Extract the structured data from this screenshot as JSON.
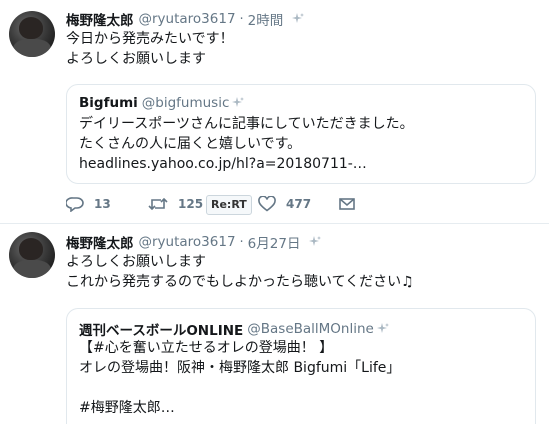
{
  "tweets": [
    {
      "author_name": "梅野隆太郎",
      "handle": "@ryutaro3617",
      "time": "2時間",
      "text_lines": [
        "今日から発売みたいです！",
        "よろしくお願いします"
      ],
      "quote": {
        "author_name": "Bigfumi",
        "handle": "@bigfumusic",
        "lines": [
          "デイリースポーツさんに記事にしていただきました。",
          "たくさんの人に届くと嬉しいです。",
          " headlines.yahoo.co.jp/hl?a=20180711-…"
        ]
      },
      "actions": {
        "reply_count": "13",
        "retweet_count": "125",
        "rert_label": "Re:RT",
        "like_count": "477"
      }
    },
    {
      "author_name": "梅野隆太郎",
      "handle": "@ryutaro3617",
      "time": "6月27日",
      "text_lines": [
        "よろしくお願いします",
        "これから発売するのでもしよかったら聴いてください♫"
      ],
      "quote": {
        "author_name": "週刊ベースボールONLINE",
        "handle": "@BaseBallMOnline",
        "lines": [
          "【#心を奮い立たせるオレの登場曲！ 】",
          "オレの登場曲！阪神・梅野隆太郎 Bigfumi「Life」",
          "",
          "#梅野隆太郎…"
        ]
      }
    }
  ],
  "separator": "·",
  "icons": {
    "reply": "reply-icon",
    "retweet": "retweet-icon",
    "like": "heart-icon",
    "dm": "envelope-icon",
    "sparkle": "sparkle-icon"
  },
  "colors": {
    "text": "#14171a",
    "muted": "#657786",
    "border": "#e1e8ed"
  }
}
